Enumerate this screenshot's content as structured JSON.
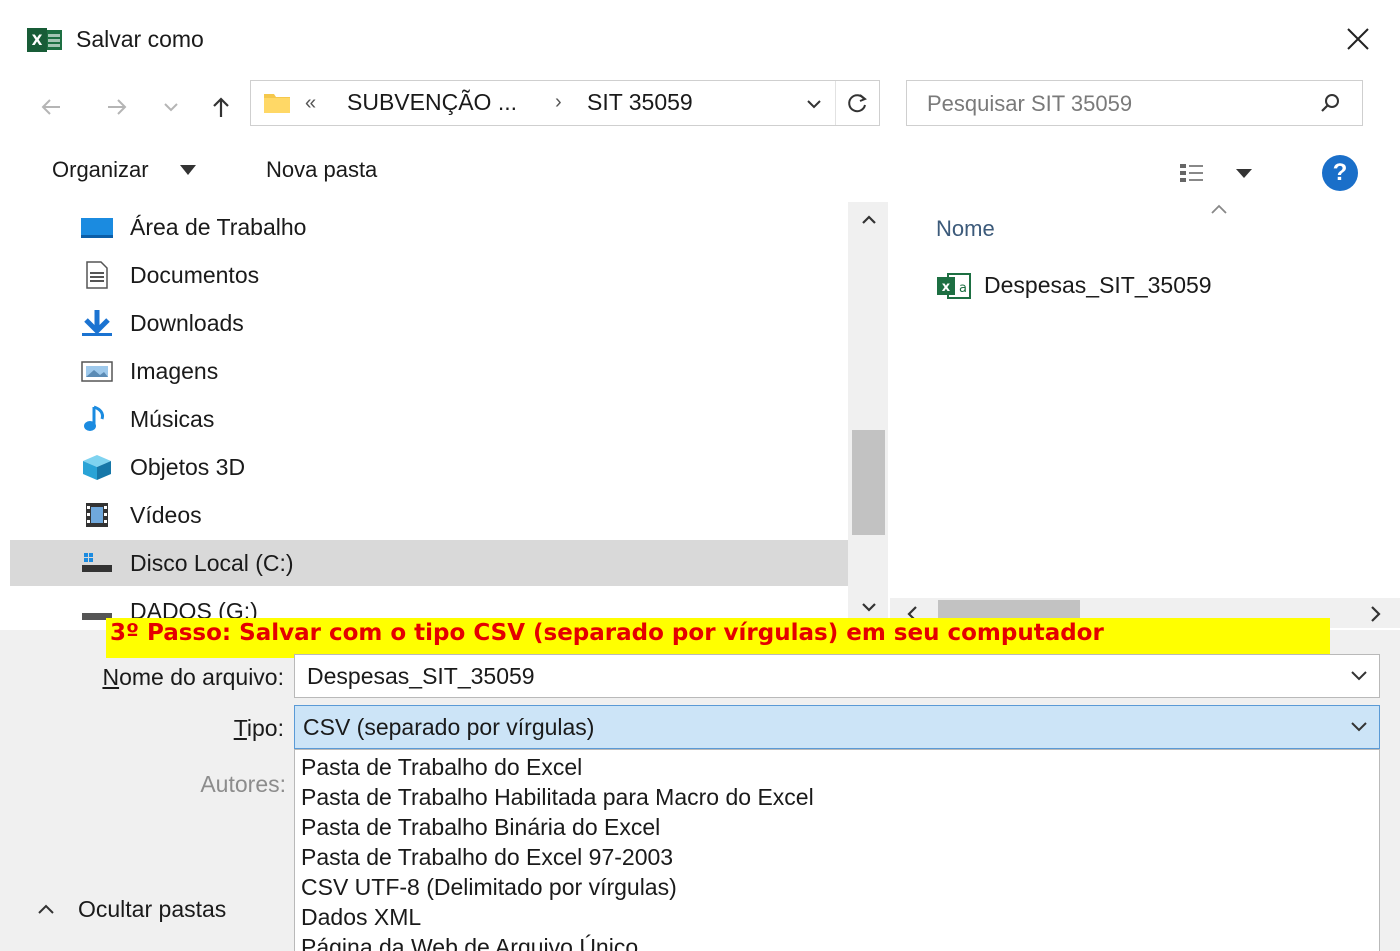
{
  "window": {
    "title": "Salvar como",
    "app_icon": "excel-icon",
    "close_icon": "close-icon"
  },
  "navigation": {
    "back_icon": "arrow-left-icon",
    "forward_icon": "arrow-right-icon",
    "recent_icon": "chevron-down-icon",
    "up_icon": "arrow-up-icon",
    "address": {
      "prefix": "«",
      "segments": [
        "SUBVENÇÃO ...",
        "SIT 35059"
      ],
      "separator": "›",
      "refresh_icon": "refresh-icon"
    },
    "search": {
      "placeholder": "Pesquisar SIT 35059",
      "icon": "search-icon"
    }
  },
  "toolbar": {
    "organize_label": "Organizar",
    "new_folder_label": "Nova pasta",
    "view_icon": "view-options-icon",
    "help_label": "?"
  },
  "nav_pane": {
    "items": [
      {
        "label": "Área de Trabalho",
        "icon": "desktop-icon"
      },
      {
        "label": "Documentos",
        "icon": "documents-icon"
      },
      {
        "label": "Downloads",
        "icon": "downloads-icon"
      },
      {
        "label": "Imagens",
        "icon": "pictures-icon"
      },
      {
        "label": "Músicas",
        "icon": "music-icon"
      },
      {
        "label": "Objetos 3D",
        "icon": "objects-3d-icon"
      },
      {
        "label": "Vídeos",
        "icon": "videos-icon"
      },
      {
        "label": "Disco Local (C:)",
        "icon": "drive-icon",
        "selected": true
      },
      {
        "label": "DADOS (G:)",
        "icon": "drive-icon"
      }
    ]
  },
  "file_list": {
    "column_header": "Nome",
    "files": [
      {
        "name": "Despesas_SIT_35059",
        "icon": "excel-file-icon"
      }
    ]
  },
  "annotation": {
    "text": "3º Passo: Salvar com o tipo CSV (separado por vírgulas) em seu computador",
    "background": "#ffff00",
    "color": "#e40000"
  },
  "form": {
    "filename_label": "Nome do arquivo:",
    "filename_value": "Despesas_SIT_35059",
    "type_label": "Tipo:",
    "type_value": "CSV (separado por vírgulas)",
    "authors_label": "Autores:",
    "type_options": [
      "Pasta de Trabalho do Excel",
      "Pasta de Trabalho Habilitada para Macro do Excel",
      "Pasta de Trabalho Binária do Excel",
      "Pasta de Trabalho do Excel 97-2003",
      "CSV UTF-8 (Delimitado por vírgulas)",
      "Dados XML",
      "Página da Web de Arquivo Único"
    ]
  },
  "footer": {
    "hide_folders_label": "Ocultar pastas"
  },
  "colors": {
    "accent": "#1a6fc9",
    "selection": "#d9d9d9",
    "type_highlight": "#cce4f7",
    "excel_green": "#1d6f42"
  }
}
